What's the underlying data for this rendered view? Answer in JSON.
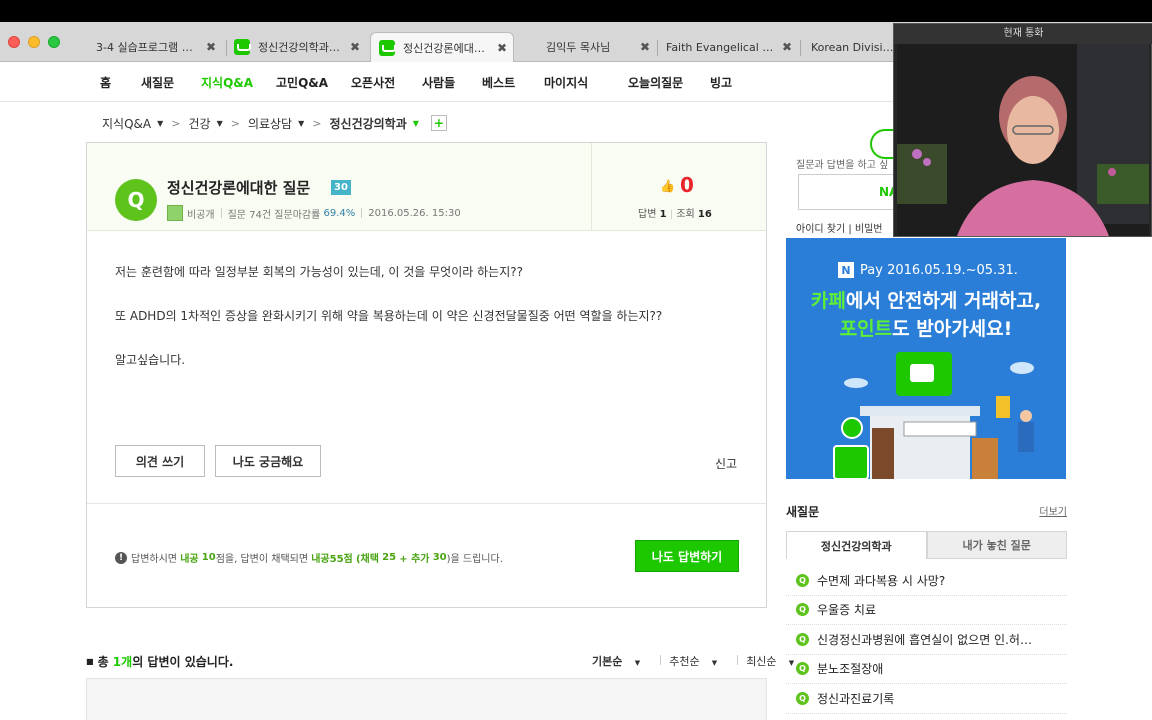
{
  "browser": {
    "tabs": [
      {
        "title": "3-4 실습프로그램 1 ...",
        "active": false,
        "favicon": false
      },
      {
        "title": "정신건강의학과 ...",
        "active": false,
        "favicon": true
      },
      {
        "title": "정신건강론에대한...",
        "active": true,
        "favicon": true
      },
      {
        "title": "김익두 목사님",
        "active": false,
        "favicon": false
      },
      {
        "title": "Faith Evangelical C...",
        "active": false,
        "favicon": false
      },
      {
        "title": "Korean Division",
        "active": false,
        "favicon": false
      }
    ],
    "close_glyph": "✖"
  },
  "nav": {
    "items": [
      "홈",
      "새질문",
      "지식Q&A",
      "고민Q&A",
      "오픈사전",
      "사람들",
      "베스트",
      "마이지식",
      "오늘의질문",
      "빙고"
    ],
    "active_index": 2
  },
  "breadcrumb": {
    "items": [
      "지식Q&A",
      "건강",
      "의료상담",
      "정신건강의학과"
    ],
    "add_label": "+"
  },
  "question": {
    "badge": "Q",
    "title": "정신건강론에대한 질문",
    "points": "30",
    "author": "비공개",
    "stats_label": "질문 74건 질문마감률",
    "close_rate": "69.4%",
    "date": "2016.05.26. 15:30",
    "likes": "0",
    "answers_label": "답변",
    "answers": "1",
    "views_label": "조회",
    "views": "16",
    "body": [
      "저는 훈련함에 따라 일정부분 회복의 가능성이 있는데, 이 것을 무엇이라 하는지??",
      "또  ADHD의 1차적인 증상을 완화시키기 위해 약을 복용하는데 이 약은 신경전달물질중 어떤 역할을 하는지??",
      "알고싶습니다."
    ],
    "opinion_button": "의견 쓰기",
    "curious_button": "나도 궁금해요",
    "report_link": "신고"
  },
  "reward": {
    "text_a": "답변하시면",
    "text_b": "내공",
    "points_answer": "10",
    "text_c": "점을, 답변이 채택되면",
    "text_d": "내공55점",
    "text_e": "(채택",
    "adopt": "25",
    "text_f": "+ 추가",
    "extra": "30",
    "text_g": ")을 드립니다.",
    "answer_button": "나도 답변하기"
  },
  "answers_section": {
    "prefix": "총",
    "count": "1개",
    "suffix": "의 답변이 있습니다.",
    "sort_options": [
      "기본순",
      "추천순",
      "최신순"
    ]
  },
  "login": {
    "hint": "질문과 답변을 하고 싶",
    "button": "NA",
    "links": "아이디 찾기 | 비밀번"
  },
  "ad": {
    "pay": "Pay",
    "pay_logo": "N",
    "period": "2016.05.19.~05.31.",
    "line1_hl": "카페",
    "line1": "에서 안전하게 거래하고,",
    "line2_hl": "포인트",
    "line2": "도 받아가세요!"
  },
  "new_questions": {
    "title": "새질문",
    "more": "더보기",
    "tabs": [
      "정신건강의학과",
      "내가 놓친 질문"
    ],
    "items": [
      "수면제 과다복용 시 사망?",
      "우울증 치료",
      "신경정신과병원에 흡연실이 없으면 인.허…",
      "분노조절장애",
      "정신과진료기록"
    ]
  },
  "video_call": {
    "title": "현재 통화"
  },
  "colors": {
    "brand_green": "#1ec800",
    "ad_blue": "#2b7ed8",
    "like_red": "#e8242c"
  }
}
